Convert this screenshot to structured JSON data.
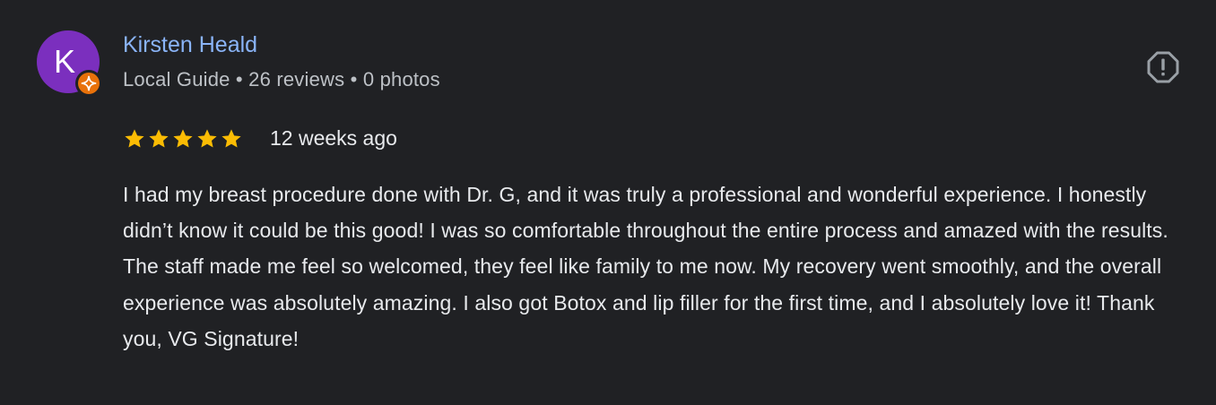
{
  "review": {
    "avatar_letter": "K",
    "author_name": "Kirsten Heald",
    "author_meta": "Local Guide • 26 reviews • 0 photos",
    "rating": 5,
    "rating_max": 5,
    "time_ago": "12 weeks ago",
    "text": "I had my breast procedure done with Dr. G, and it was truly a professional and wonderful experience. I honestly didn’t know it could be this good! I was so comfortable throughout the entire process and amazed with the results. The staff made me feel so welcomed, they feel like family to me now. My recovery went smoothly, and the overall experience was absolutely amazing. I also got Botox and lip filler for the first time, and I absolutely love it! Thank you, VG Signature!"
  },
  "icons": {
    "guide_badge": "local-guide-star-icon",
    "report": "report-alert-icon",
    "star": "star-icon"
  },
  "colors": {
    "background": "#202124",
    "author_name": "#8ab4f8",
    "avatar": "#7b2fbe",
    "guide_badge": "#e8710a",
    "star": "#fbbc04",
    "text": "#e8eaed",
    "meta": "#bdc1c6"
  }
}
